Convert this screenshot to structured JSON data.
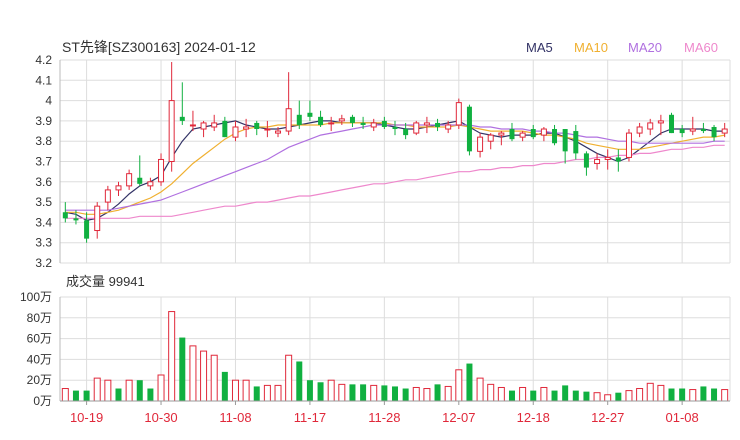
{
  "title": "ST先锋[SZ300163] 2024-01-12",
  "volume_label": "成交量 99941",
  "legend": [
    {
      "name": "MA5",
      "color": "#333366"
    },
    {
      "name": "MA10",
      "color": "#f0b030"
    },
    {
      "name": "MA20",
      "color": "#b070e0"
    },
    {
      "name": "MA60",
      "color": "#ee88cc"
    }
  ],
  "colors": {
    "up": "#e0283a",
    "down": "#10b040",
    "grid": "#dddddd",
    "axis_text": "#333333"
  },
  "chart_data": [
    {
      "type": "candlestick",
      "title": "ST先锋[SZ300163] 2024-01-12",
      "ylim": [
        3.2,
        4.2
      ],
      "yticks": [
        "4.2",
        "4.1",
        "4",
        "3.9",
        "3.8",
        "3.7",
        "3.6",
        "3.5",
        "3.4",
        "3.3",
        "3.2"
      ],
      "x": [
        "10-17",
        "10-18",
        "10-19",
        "10-20",
        "10-23",
        "10-24",
        "10-25",
        "10-26",
        "10-27",
        "10-30",
        "10-31",
        "11-01",
        "11-02",
        "11-03",
        "11-06",
        "11-07",
        "11-08",
        "11-09",
        "11-10",
        "11-13",
        "11-14",
        "11-15",
        "11-16",
        "11-17",
        "11-20",
        "11-21",
        "11-22",
        "11-23",
        "11-24",
        "11-27",
        "11-28",
        "11-29",
        "11-30",
        "12-01",
        "12-04",
        "12-05",
        "12-06",
        "12-07",
        "12-08",
        "12-11",
        "12-12",
        "12-13",
        "12-14",
        "12-15",
        "12-18",
        "12-19",
        "12-20",
        "12-21",
        "12-22",
        "12-25",
        "12-26",
        "12-27",
        "12-28",
        "12-29",
        "01-02",
        "01-03",
        "01-04",
        "01-05",
        "01-08",
        "01-09",
        "01-10",
        "01-11",
        "01-12"
      ],
      "xticks": [
        "10-19",
        "10-30",
        "11-08",
        "11-17",
        "11-28",
        "12-07",
        "12-18",
        "12-27",
        "01-08"
      ],
      "ohlc": [
        [
          3.45,
          3.5,
          3.4,
          3.42
        ],
        [
          3.42,
          3.46,
          3.39,
          3.41
        ],
        [
          3.41,
          3.45,
          3.3,
          3.32
        ],
        [
          3.36,
          3.5,
          3.32,
          3.48
        ],
        [
          3.5,
          3.58,
          3.46,
          3.56
        ],
        [
          3.56,
          3.6,
          3.53,
          3.58
        ],
        [
          3.58,
          3.66,
          3.56,
          3.64
        ],
        [
          3.62,
          3.73,
          3.58,
          3.59
        ],
        [
          3.58,
          3.62,
          3.56,
          3.6
        ],
        [
          3.6,
          3.74,
          3.58,
          3.71
        ],
        [
          3.7,
          4.19,
          3.65,
          4.0
        ],
        [
          3.92,
          4.09,
          3.88,
          3.9
        ],
        [
          3.88,
          3.95,
          3.85,
          3.88
        ],
        [
          3.86,
          3.9,
          3.82,
          3.89
        ],
        [
          3.87,
          3.93,
          3.85,
          3.89
        ],
        [
          3.9,
          3.92,
          3.82,
          3.82
        ],
        [
          3.82,
          3.9,
          3.8,
          3.87
        ],
        [
          3.86,
          3.91,
          3.82,
          3.87
        ],
        [
          3.89,
          3.9,
          3.83,
          3.86
        ],
        [
          3.86,
          3.9,
          3.82,
          3.86
        ],
        [
          3.84,
          3.87,
          3.82,
          3.85
        ],
        [
          3.85,
          4.14,
          3.83,
          3.96
        ],
        [
          3.93,
          4.0,
          3.86,
          3.88
        ],
        [
          3.94,
          4.0,
          3.9,
          3.92
        ],
        [
          3.92,
          3.95,
          3.87,
          3.88
        ],
        [
          3.89,
          3.92,
          3.85,
          3.89
        ],
        [
          3.9,
          3.93,
          3.88,
          3.91
        ],
        [
          3.92,
          3.93,
          3.87,
          3.89
        ],
        [
          3.89,
          3.92,
          3.86,
          3.88
        ],
        [
          3.87,
          3.91,
          3.85,
          3.89
        ],
        [
          3.9,
          3.92,
          3.86,
          3.87
        ],
        [
          3.87,
          3.9,
          3.83,
          3.86
        ],
        [
          3.86,
          3.89,
          3.81,
          3.83
        ],
        [
          3.84,
          3.9,
          3.83,
          3.89
        ],
        [
          3.88,
          3.92,
          3.84,
          3.89
        ],
        [
          3.89,
          3.91,
          3.85,
          3.87
        ],
        [
          3.86,
          3.9,
          3.84,
          3.88
        ],
        [
          3.88,
          4.01,
          3.86,
          3.99
        ],
        [
          3.97,
          3.98,
          3.73,
          3.75
        ],
        [
          3.75,
          3.84,
          3.72,
          3.82
        ],
        [
          3.8,
          3.84,
          3.76,
          3.83
        ],
        [
          3.83,
          3.85,
          3.78,
          3.84
        ],
        [
          3.86,
          3.89,
          3.8,
          3.81
        ],
        [
          3.82,
          3.85,
          3.8,
          3.84
        ],
        [
          3.86,
          3.88,
          3.81,
          3.82
        ],
        [
          3.83,
          3.87,
          3.8,
          3.86
        ],
        [
          3.86,
          3.88,
          3.78,
          3.79
        ],
        [
          3.86,
          3.86,
          3.69,
          3.75
        ],
        [
          3.85,
          3.88,
          3.71,
          3.74
        ],
        [
          3.74,
          3.75,
          3.63,
          3.67
        ],
        [
          3.69,
          3.74,
          3.66,
          3.71
        ],
        [
          3.71,
          3.76,
          3.66,
          3.72
        ],
        [
          3.72,
          3.76,
          3.65,
          3.7
        ],
        [
          3.72,
          3.86,
          3.7,
          3.84
        ],
        [
          3.84,
          3.89,
          3.82,
          3.87
        ],
        [
          3.86,
          3.91,
          3.83,
          3.89
        ],
        [
          3.89,
          3.93,
          3.83,
          3.9
        ],
        [
          3.93,
          3.94,
          3.84,
          3.84
        ],
        [
          3.86,
          3.88,
          3.82,
          3.84
        ],
        [
          3.85,
          3.92,
          3.83,
          3.86
        ],
        [
          3.86,
          3.89,
          3.84,
          3.85
        ],
        [
          3.87,
          3.88,
          3.8,
          3.82
        ],
        [
          3.84,
          3.89,
          3.82,
          3.86
        ]
      ],
      "ma": {
        "MA5": [
          3.45,
          3.44,
          3.41,
          3.42,
          3.45,
          3.49,
          3.54,
          3.58,
          3.6,
          3.63,
          3.72,
          3.8,
          3.86,
          3.87,
          3.88,
          3.89,
          3.9,
          3.88,
          3.87,
          3.86,
          3.86,
          3.87,
          3.88,
          3.89,
          3.9,
          3.9,
          3.89,
          3.89,
          3.89,
          3.89,
          3.88,
          3.87,
          3.86,
          3.86,
          3.87,
          3.88,
          3.89,
          3.9,
          3.87,
          3.84,
          3.83,
          3.82,
          3.83,
          3.83,
          3.83,
          3.84,
          3.84,
          3.82,
          3.8,
          3.77,
          3.74,
          3.72,
          3.7,
          3.72,
          3.76,
          3.8,
          3.84,
          3.86,
          3.86,
          3.86,
          3.86,
          3.85,
          3.85
        ],
        "MA10": [
          3.45,
          3.45,
          3.44,
          3.44,
          3.45,
          3.46,
          3.48,
          3.5,
          3.52,
          3.55,
          3.59,
          3.64,
          3.69,
          3.73,
          3.77,
          3.81,
          3.84,
          3.86,
          3.87,
          3.87,
          3.88,
          3.88,
          3.88,
          3.88,
          3.88,
          3.89,
          3.89,
          3.89,
          3.89,
          3.89,
          3.89,
          3.88,
          3.88,
          3.87,
          3.87,
          3.87,
          3.87,
          3.88,
          3.87,
          3.86,
          3.85,
          3.85,
          3.85,
          3.85,
          3.84,
          3.83,
          3.83,
          3.82,
          3.81,
          3.79,
          3.78,
          3.77,
          3.76,
          3.76,
          3.76,
          3.77,
          3.78,
          3.79,
          3.8,
          3.81,
          3.82,
          3.82,
          3.83
        ],
        "MA20": [
          3.46,
          3.46,
          3.46,
          3.46,
          3.46,
          3.47,
          3.48,
          3.49,
          3.5,
          3.51,
          3.53,
          3.55,
          3.57,
          3.59,
          3.61,
          3.63,
          3.65,
          3.67,
          3.69,
          3.71,
          3.74,
          3.77,
          3.79,
          3.81,
          3.83,
          3.84,
          3.85,
          3.86,
          3.87,
          3.88,
          3.88,
          3.88,
          3.88,
          3.88,
          3.88,
          3.88,
          3.88,
          3.88,
          3.88,
          3.87,
          3.87,
          3.86,
          3.86,
          3.86,
          3.85,
          3.85,
          3.84,
          3.84,
          3.83,
          3.82,
          3.82,
          3.81,
          3.8,
          3.8,
          3.79,
          3.79,
          3.79,
          3.79,
          3.79,
          3.79,
          3.79,
          3.8,
          3.8
        ],
        "MA60": [
          3.42,
          3.42,
          3.42,
          3.42,
          3.42,
          3.42,
          3.42,
          3.43,
          3.43,
          3.43,
          3.43,
          3.44,
          3.45,
          3.46,
          3.47,
          3.48,
          3.48,
          3.49,
          3.5,
          3.5,
          3.51,
          3.52,
          3.53,
          3.53,
          3.54,
          3.55,
          3.56,
          3.57,
          3.58,
          3.59,
          3.59,
          3.6,
          3.61,
          3.61,
          3.62,
          3.63,
          3.64,
          3.65,
          3.65,
          3.66,
          3.66,
          3.67,
          3.67,
          3.68,
          3.68,
          3.69,
          3.69,
          3.7,
          3.71,
          3.71,
          3.72,
          3.72,
          3.73,
          3.73,
          3.74,
          3.74,
          3.75,
          3.76,
          3.76,
          3.77,
          3.77,
          3.78,
          3.78
        ]
      }
    },
    {
      "type": "bar",
      "title": "成交量 99941",
      "unit": "万",
      "ylim": [
        0,
        100
      ],
      "yticks": [
        "100万",
        "80万",
        "60万",
        "40万",
        "20万",
        "0万"
      ],
      "values": [
        12,
        10,
        10,
        22,
        20,
        12,
        20,
        20,
        12,
        25,
        86,
        61,
        53,
        48,
        44,
        28,
        20,
        20,
        14,
        15,
        15,
        44,
        38,
        20,
        18,
        20,
        16,
        16,
        16,
        15,
        15,
        14,
        12,
        13,
        12,
        16,
        14,
        30,
        36,
        22,
        16,
        13,
        10,
        13,
        10,
        13,
        10,
        15,
        10,
        9,
        8,
        6,
        8,
        10,
        12,
        17,
        15,
        12,
        12,
        11,
        14,
        12,
        11
      ],
      "direction": [
        "u",
        "d",
        "d",
        "u",
        "u",
        "d",
        "u",
        "d",
        "d",
        "u",
        "u",
        "d",
        "u",
        "u",
        "u",
        "d",
        "u",
        "u",
        "d",
        "u",
        "u",
        "u",
        "d",
        "d",
        "d",
        "u",
        "u",
        "d",
        "d",
        "u",
        "d",
        "d",
        "d",
        "u",
        "u",
        "d",
        "u",
        "u",
        "d",
        "u",
        "u",
        "u",
        "d",
        "u",
        "d",
        "u",
        "d",
        "d",
        "d",
        "d",
        "u",
        "u",
        "d",
        "u",
        "u",
        "u",
        "u",
        "d",
        "d",
        "u",
        "d",
        "d",
        "u"
      ]
    }
  ]
}
